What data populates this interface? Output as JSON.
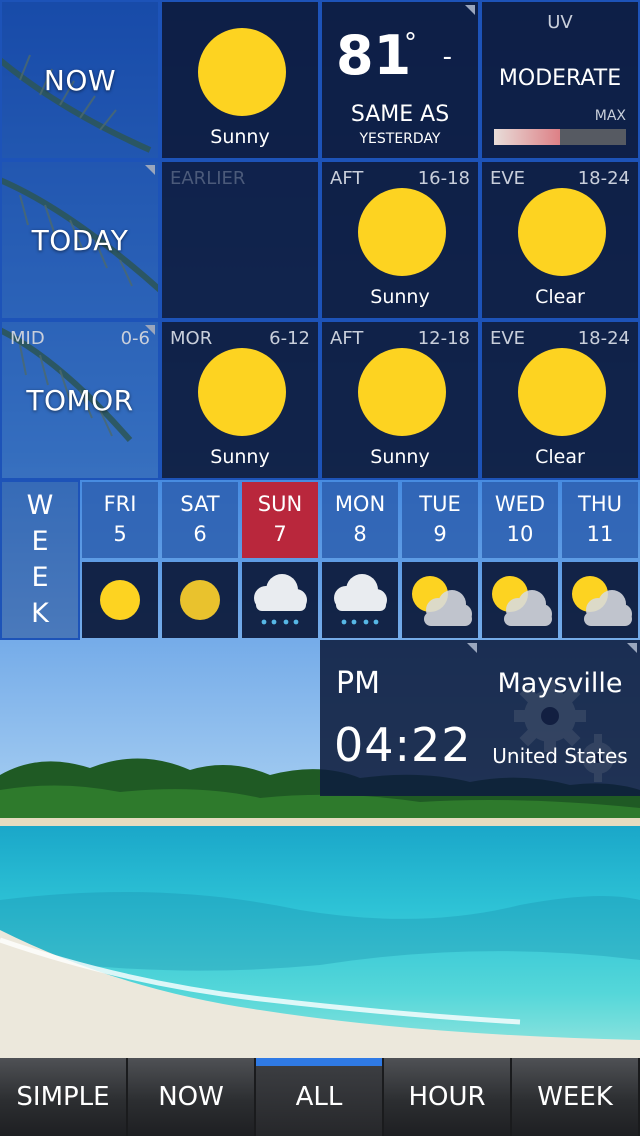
{
  "now": {
    "label": "NOW",
    "condition": "Sunny",
    "temperature": "81",
    "degree_symbol": "°",
    "trend": "-",
    "comparison": "SAME AS",
    "comparison_ref": "YESTERDAY"
  },
  "uv": {
    "title": "UV",
    "level": "MODERATE",
    "max_label": "MAX",
    "level_fraction": 0.5
  },
  "today": {
    "label": "TODAY",
    "periods": [
      {
        "name": "EARLIER",
        "range": "",
        "condition": ""
      },
      {
        "name": "AFT",
        "range": "16-18",
        "condition": "Sunny"
      },
      {
        "name": "EVE",
        "range": "18-24",
        "condition": "Clear"
      }
    ]
  },
  "tomorrow": {
    "label": "TOMOR",
    "first_period": {
      "name": "MID",
      "range": "0-6"
    },
    "periods": [
      {
        "name": "MOR",
        "range": "6-12",
        "condition": "Sunny"
      },
      {
        "name": "AFT",
        "range": "12-18",
        "condition": "Sunny"
      },
      {
        "name": "EVE",
        "range": "18-24",
        "condition": "Clear"
      }
    ]
  },
  "week": {
    "label_letters": [
      "W",
      "E",
      "E",
      "K"
    ],
    "days": [
      {
        "name": "FRI",
        "date": "5",
        "icon": "sun-icon",
        "active": false
      },
      {
        "name": "SAT",
        "date": "6",
        "icon": "sun-icon",
        "active": false
      },
      {
        "name": "SUN",
        "date": "7",
        "icon": "rain-cloud-icon",
        "active": true
      },
      {
        "name": "MON",
        "date": "8",
        "icon": "rain-cloud-icon",
        "active": false
      },
      {
        "name": "TUE",
        "date": "9",
        "icon": "partly-cloudy-icon",
        "active": false
      },
      {
        "name": "WED",
        "date": "10",
        "icon": "partly-cloudy-icon",
        "active": false
      },
      {
        "name": "THU",
        "date": "11",
        "icon": "partly-cloudy-icon",
        "active": false
      }
    ]
  },
  "clock": {
    "meridiem": "PM",
    "time": "04:22"
  },
  "location": {
    "city": "Maysville",
    "country": "United States",
    "icon": "gear-icon"
  },
  "nav": {
    "items": [
      "SIMPLE",
      "NOW",
      "ALL",
      "HOUR",
      "WEEK"
    ],
    "active": "ALL"
  },
  "colors": {
    "accent": "#1d53b8",
    "sun": "#fdd321",
    "active_day": "#b9273c",
    "nav_highlight": "#2f7ae5"
  }
}
